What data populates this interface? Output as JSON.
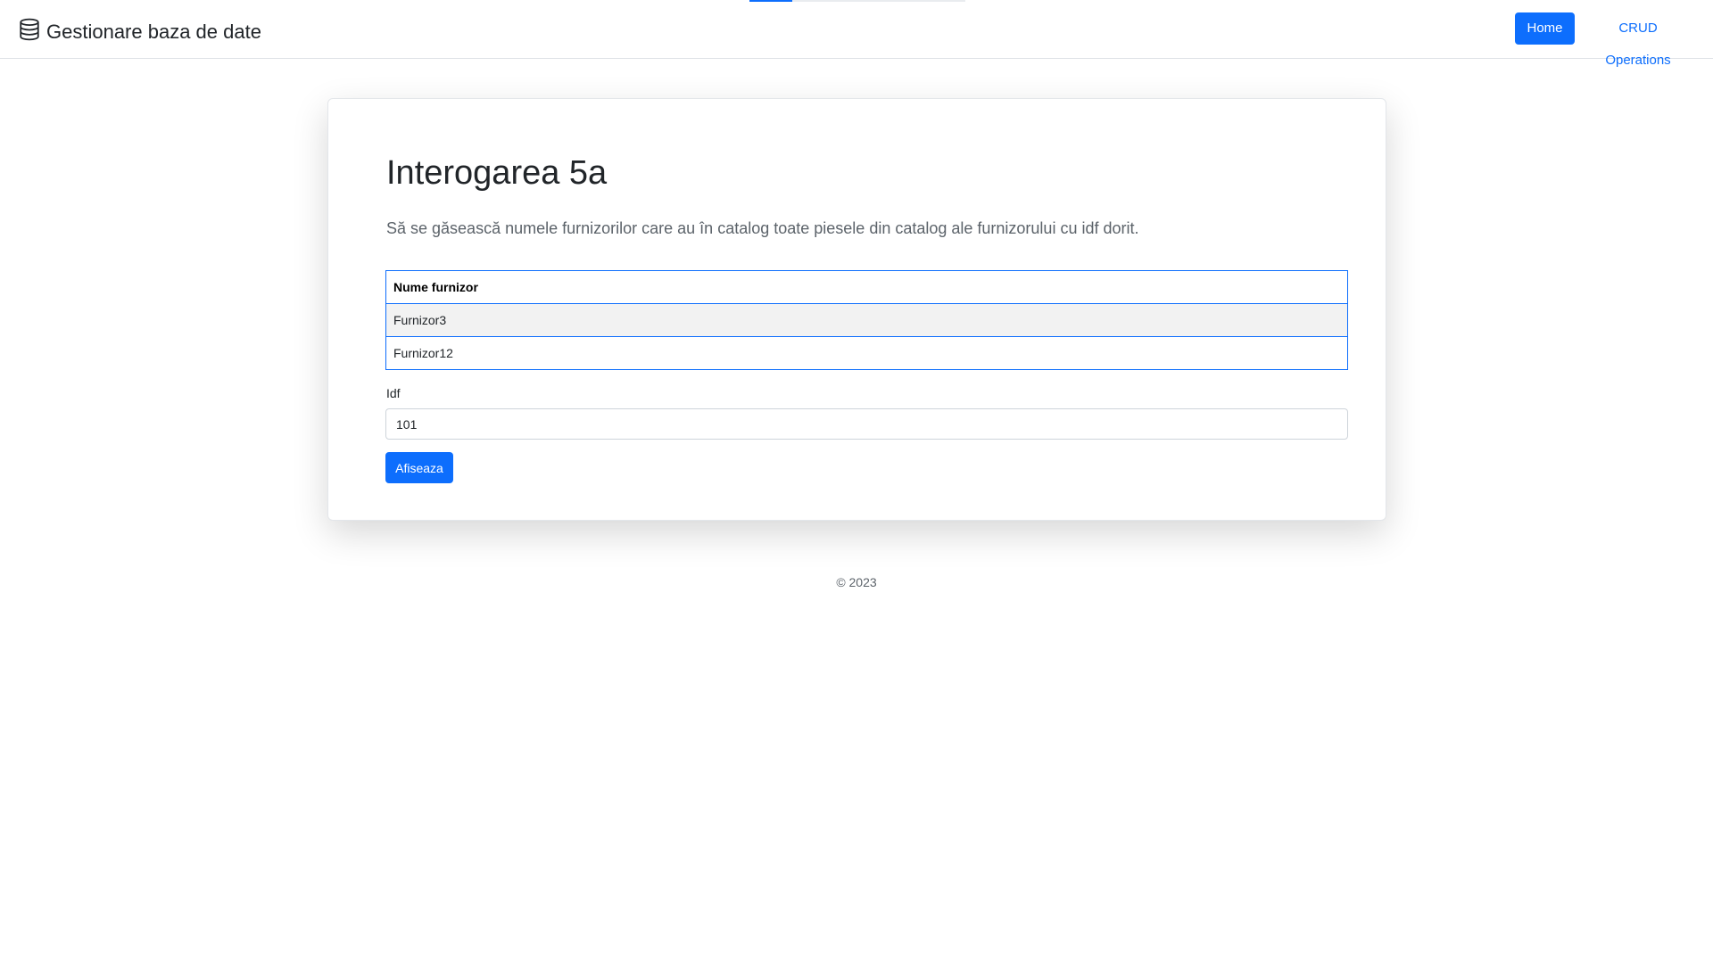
{
  "navbar": {
    "brand": "Gestionare baza de date",
    "brand_icon": "database-icon",
    "links": [
      {
        "label": "Home",
        "active": true
      },
      {
        "label": "CRUD Operations",
        "active": false
      }
    ]
  },
  "main": {
    "title": "Interogarea 5a",
    "description": "Să se găsească numele furnizorilor care au în catalog toate piesele din catalog ale furnizorului cu idf dorit.",
    "table": {
      "headers": [
        "Nume furnizor"
      ],
      "rows": [
        [
          "Furnizor3"
        ],
        [
          "Furnizor12"
        ]
      ]
    },
    "form": {
      "idf_label": "Idf",
      "idf_value": "101",
      "submit_label": "Afiseaza"
    }
  },
  "footer": {
    "text": "© 2023"
  },
  "colors": {
    "primary": "#0d6efd",
    "table_border": "#0d6efd",
    "striped_row": "#f2f2f2"
  }
}
